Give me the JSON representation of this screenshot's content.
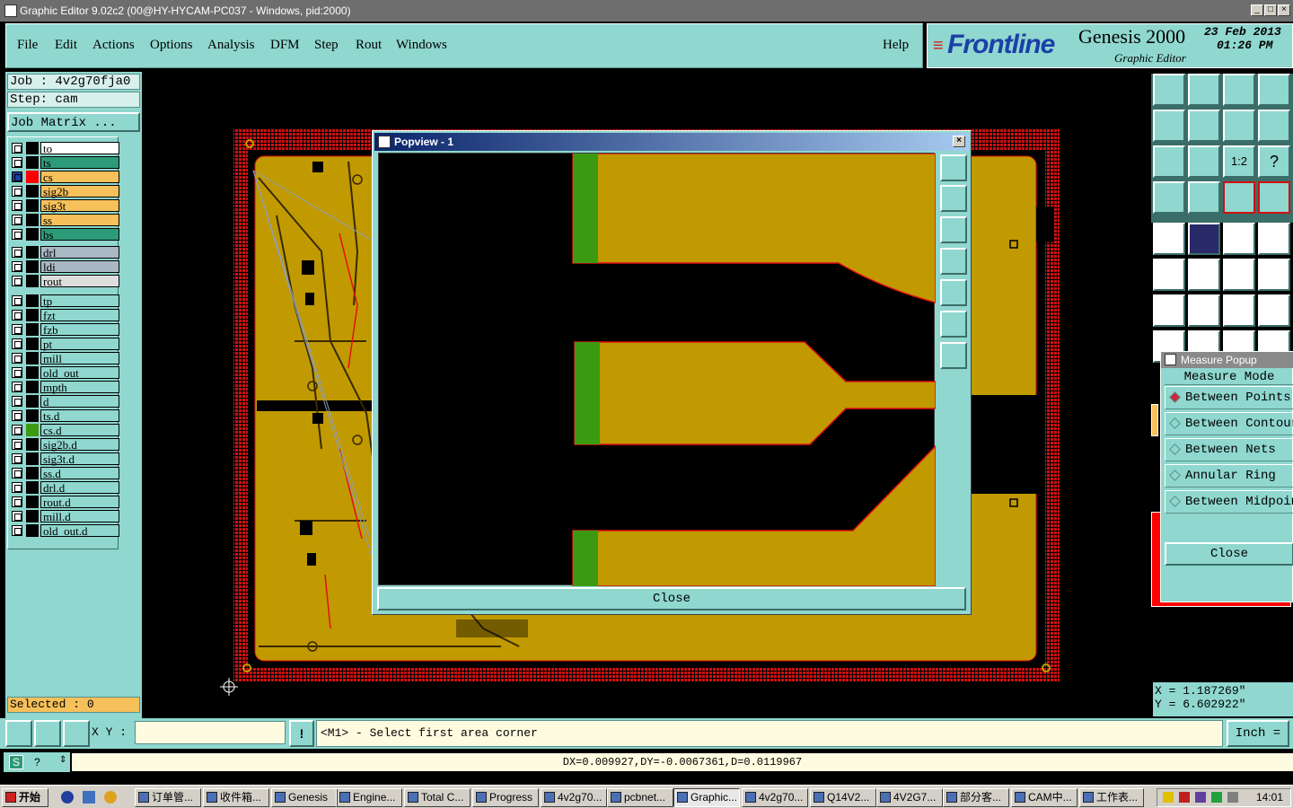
{
  "window": {
    "title": "Graphic Editor 9.02c2 (00@HY-HYCAM-PC037 - Windows, pid:2000)"
  },
  "menu": {
    "items": [
      "File",
      "Edit",
      "Actions",
      "Options",
      "Analysis",
      "DFM",
      "Step",
      "Rout",
      "Windows"
    ],
    "help": "Help"
  },
  "brand": {
    "logo": "Frontline",
    "product": "Genesis 2000",
    "subtitle": "Graphic Editor",
    "date": "23 Feb 2013",
    "time": "01:26 PM"
  },
  "job": {
    "job_label": "Job : 4v2g70fja0",
    "step_label": "Step: cam",
    "matrix_button": "Job Matrix ..."
  },
  "layers": [
    {
      "name": "to",
      "color": "#ffffff"
    },
    {
      "name": "ts",
      "color": "#2e9b78"
    },
    {
      "name": "cs",
      "color": "#f6c05a"
    },
    {
      "name": "sig2b",
      "color": "#f6c05a"
    },
    {
      "name": "sig3t",
      "color": "#f6c05a"
    },
    {
      "name": "ss",
      "color": "#f6c05a"
    },
    {
      "name": "bs",
      "color": "#2e9b78"
    },
    {
      "name": "drl",
      "color": "#aab8c4"
    },
    {
      "name": "ldi",
      "color": "#aab8c4"
    },
    {
      "name": "rout",
      "color": "#dedede"
    },
    {
      "name": "tp",
      "color": "#8fd7cf"
    },
    {
      "name": "fzt",
      "color": "#8fd7cf"
    },
    {
      "name": "fzb",
      "color": "#8fd7cf"
    },
    {
      "name": "pt",
      "color": "#8fd7cf"
    },
    {
      "name": "mill",
      "color": "#8fd7cf"
    },
    {
      "name": "old_out",
      "color": "#8fd7cf"
    },
    {
      "name": "mpth",
      "color": "#8fd7cf"
    },
    {
      "name": "d",
      "color": "#8fd7cf"
    },
    {
      "name": "ts.d",
      "color": "#8fd7cf"
    },
    {
      "name": "cs.d",
      "color": "#8fd7cf"
    },
    {
      "name": "sig2b.d",
      "color": "#8fd7cf"
    },
    {
      "name": "sig3t.d",
      "color": "#8fd7cf"
    },
    {
      "name": "ss.d",
      "color": "#8fd7cf"
    },
    {
      "name": "drl.d",
      "color": "#8fd7cf"
    },
    {
      "name": "rout.d",
      "color": "#8fd7cf"
    },
    {
      "name": "mill.d",
      "color": "#8fd7cf"
    },
    {
      "name": "old_out.d",
      "color": "#8fd7cf"
    }
  ],
  "selected": "Selected : 0",
  "popview": {
    "title": "Popview - 1",
    "close_label": "Close"
  },
  "measure": {
    "title": "Measure Popup",
    "mode_label": "Measure Mode",
    "options": [
      "Between Points",
      "Between Contours",
      "Between Nets",
      "Annular Ring",
      "Between Midpoints"
    ],
    "close_label": "Close"
  },
  "coords": {
    "x": "X = 1.187269\"",
    "y": "Y = 6.602922\""
  },
  "command": {
    "xy_label": "X Y :",
    "prompt": "<M1> - Select first area corner",
    "units": "Inch"
  },
  "status": {
    "text": "DX=0.009927,DY=-0.0067361,D=0.0119967"
  },
  "taskbar": {
    "start": "开始",
    "tasks": [
      "订单管...",
      "收件箱...",
      "Genesis",
      "Engine...",
      "Total C...",
      "Progress",
      "4v2g70...",
      "pcbnet...",
      "Graphic...",
      "4v2g70...",
      "Q14V2...",
      "4V2G7...",
      "部分客...",
      "CAM中...",
      "工作表..."
    ],
    "clock": "14:01"
  },
  "colors": {
    "panel": "#8fd7cf",
    "copper": "#c09a00",
    "trace_edge": "#e01010",
    "mask_green": "#3c9a10",
    "accent_red": "#ff0000"
  }
}
